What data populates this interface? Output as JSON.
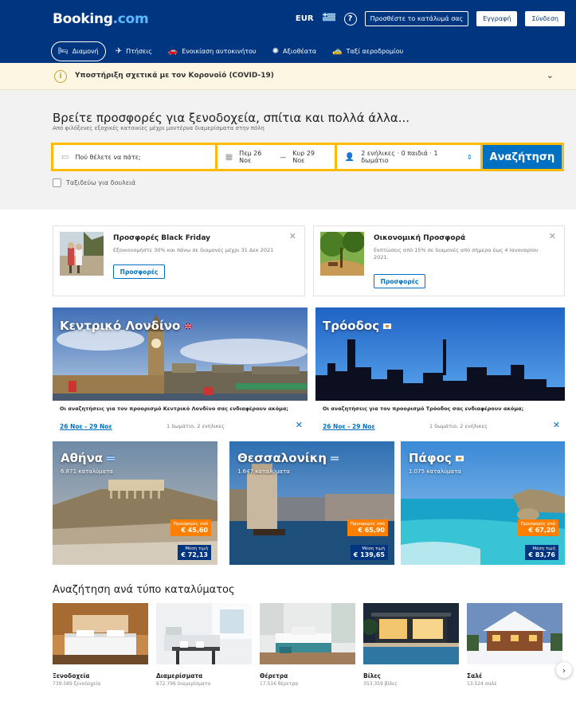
{
  "header": {
    "logo_main": "Booking",
    "logo_suffix": ".com",
    "currency": "EUR",
    "help": "?",
    "list_property": "Προσθέστε το κατάλυμά σας",
    "register": "Εγγραφή",
    "signin": "Σύνδεση"
  },
  "nav": [
    {
      "label": "Διαμονή",
      "icon": "bed-icon",
      "active": true
    },
    {
      "label": "Πτήσεις",
      "icon": "plane-icon"
    },
    {
      "label": "Ενοικίαση αυτοκινήτου",
      "icon": "car-icon"
    },
    {
      "label": "Αξιοθέατα",
      "icon": "attractions-icon"
    },
    {
      "label": "Ταξί αεροδρομίου",
      "icon": "taxi-icon"
    }
  ],
  "covid": {
    "text": "Υποστήριξη σχετικά με τον Κορονοϊό (COVID-19)"
  },
  "search": {
    "title": "Βρείτε προσφορές για ξενοδοχεία, σπίτια και πολλά άλλα...",
    "subtitle": "Από φιλόξενες εξοχικές κατοικίες μέχρι μοντέρνα διαμερίσματα στην πόλη",
    "destination_placeholder": "Πού θέλετε να πάτε;",
    "checkin": "Πεμ 26 Νοε",
    "dash": "—",
    "checkout": "Κυρ 29 Νοε",
    "guests": "2 ενήλικες · 0 παιδιά · 1 δωμάτιο",
    "button": "Αναζήτηση",
    "work_travel": "Ταξιδεύω για δουλειά"
  },
  "promos": [
    {
      "title": "Προσφορές Black Friday",
      "desc": "Εξοικονομήστε 30% και πάνω σε διαμονές μέχρι 31 Δεκ 2021",
      "button": "Προσφορές"
    },
    {
      "title": "Οικονομική Προσφορά",
      "desc": "Εκπτώσεις από 15% σε διαμονές από σήμερα έως 4 Ιανουαρίου 2021.",
      "button": "Προσφορές"
    }
  ],
  "recent": [
    {
      "name": "Κεντρικό Λονδίνο",
      "note": "Οι αναζητήσεις για τον προορισμό Κεντρικό Λονδίνο σας ενδιαφέρουν ακόμα;",
      "dates": "26 Νοε - 29 Νοε",
      "guests": "1 δωμάτιο, 2 ενήλικες",
      "close": "✕"
    },
    {
      "name": "Τρόοδος",
      "note": "Οι αναζητήσεις για τον προορισμό Τρόοδος σας ενδιαφέρουν ακόμα;",
      "dates": "26 Νοε - 29 Νοε",
      "guests": "1 δωμάτιο, 2 ενήλικες",
      "close": "✕"
    }
  ],
  "destinations": [
    {
      "name": "Αθήνα",
      "count": "6.871 καταλύματα",
      "deal_label": "Προσφορές από",
      "deal": "€ 45,60",
      "avg_label": "Μέση τιμή",
      "avg": "€ 72,13"
    },
    {
      "name": "Θεσσαλονίκη",
      "count": "1.647 καταλύματα",
      "deal_label": "Προσφορές από",
      "deal": "€ 65,90",
      "avg_label": "Μέση τιμή",
      "avg": "€ 139,65"
    },
    {
      "name": "Πάφος",
      "count": "1.075 καταλύματα",
      "deal_label": "Προσφορές από",
      "deal": "€ 67,20",
      "avg_label": "Μέση τιμή",
      "avg": "€ 83,76"
    }
  ],
  "property_types": {
    "title": "Αναζήτηση ανά τύπο καταλύματος",
    "items": [
      {
        "name": "Ξενοδοχεία",
        "count": "739.589 ξενοδοχεία"
      },
      {
        "name": "Διαμερίσματα",
        "count": "672.796 διαμερίσματα"
      },
      {
        "name": "Θέρετρα",
        "count": "17.516 θέρετρα"
      },
      {
        "name": "Βίλες",
        "count": "353.359 βίλες"
      },
      {
        "name": "Σαλέ",
        "count": "13.524 σαλέ"
      }
    ]
  },
  "colors": {
    "brand": "#003580",
    "accent": "#0071c2",
    "search_border": "#febb02",
    "deal": "#ff8000"
  }
}
